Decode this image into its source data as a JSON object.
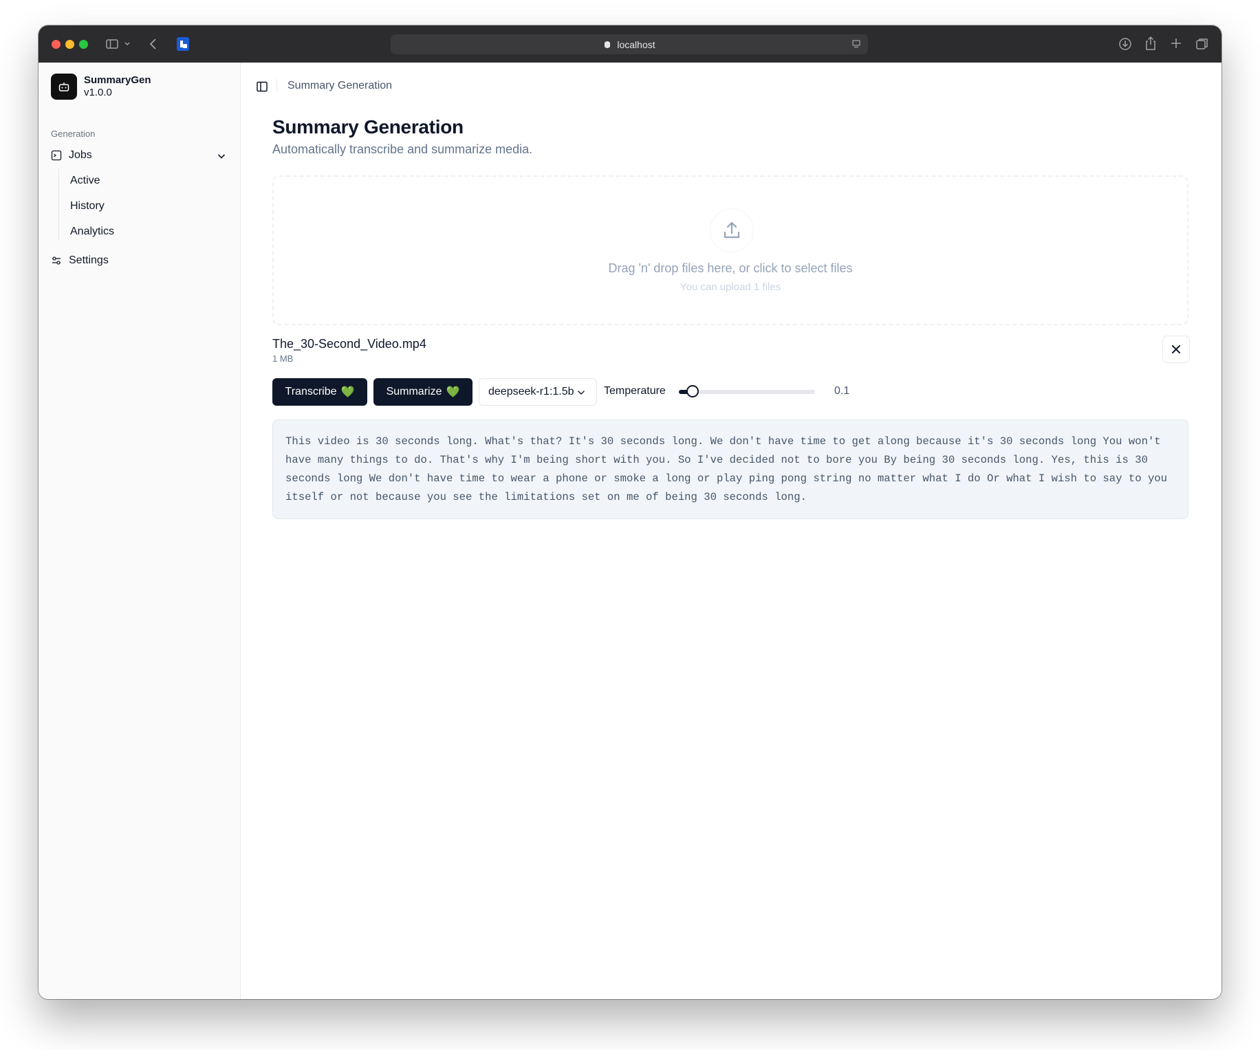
{
  "browser": {
    "url": "localhost"
  },
  "sidebar": {
    "app_name": "SummaryGen",
    "app_version": "v1.0.0",
    "group_label": "Generation",
    "jobs_label": "Jobs",
    "sub_items": [
      {
        "label": "Active"
      },
      {
        "label": "History"
      },
      {
        "label": "Analytics"
      }
    ],
    "settings_label": "Settings"
  },
  "header": {
    "breadcrumb": "Summary Generation"
  },
  "main": {
    "title": "Summary Generation",
    "subtitle": "Automatically transcribe and summarize media.",
    "dropzone": {
      "text": "Drag 'n' drop files here, or click to select files",
      "subtext": "You can upload 1 files"
    },
    "file": {
      "name": "The_30-Second_Video.mp4",
      "size": "1 MB"
    },
    "actions": {
      "transcribe_label": "Transcribe",
      "summarize_label": "Summarize",
      "status_emoji": "💚",
      "model_selected": "deepseek-r1:1.5b",
      "temperature_label": "Temperature",
      "temperature_value": "0.1",
      "temperature_fraction": 0.1
    },
    "transcript": "This video is 30 seconds long. What's that? It's 30 seconds long. We don't have time to get along because it's 30 seconds long You won't have many things to do. That's why I'm being short with you. So I've decided not to bore you By being 30 seconds long. Yes, this is 30 seconds long We don't have time to wear a phone or smoke a long or play ping pong string no matter what I do Or what I wish to say to you itself or not because you see the limitations set on me of being 30 seconds long."
  },
  "colors": {
    "primary": "#0f172a",
    "muted_text": "#64748b",
    "sidebar_bg": "#fafafa",
    "transcript_bg": "#f1f5f9"
  }
}
